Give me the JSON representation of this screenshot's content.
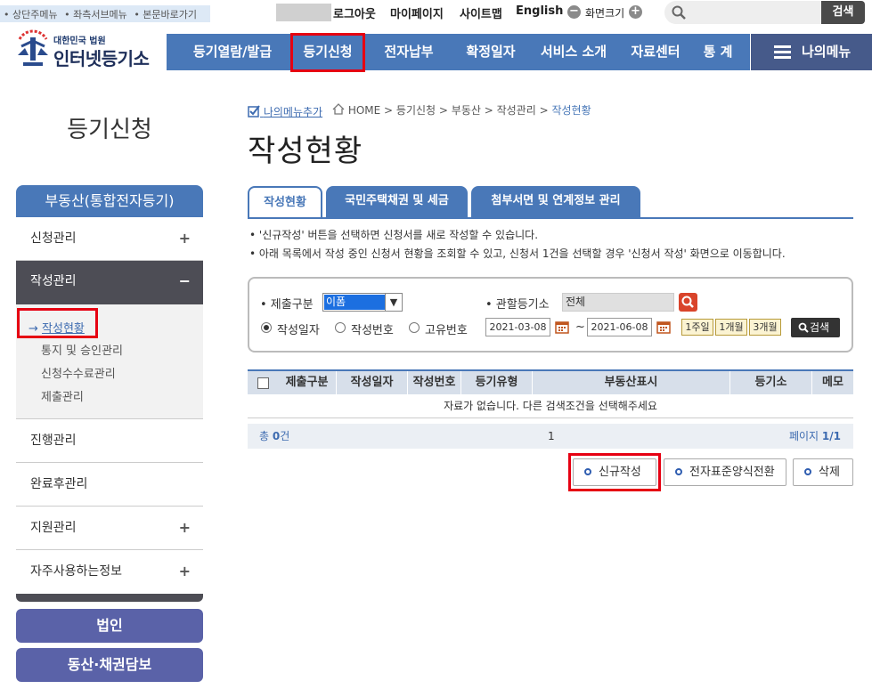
{
  "skip_links": [
    "• 상단주메뉴",
    "• 좌측서브메뉴",
    "• 본문바로가기"
  ],
  "util": {
    "logout": "로그아웃",
    "mypage": "마이페이지",
    "sitemap": "사이트맵",
    "english": "English",
    "zoom_minus": "−",
    "zoom_label": "화면크기",
    "zoom_plus": "+",
    "search_button": "검색"
  },
  "logo": {
    "org": "대한민국 법원",
    "name": "인터넷등기소"
  },
  "gnb": {
    "items": [
      "등기열람/발급",
      "등기신청",
      "전자납부",
      "확정일자",
      "서비스 소개",
      "자료센터",
      "통 계"
    ],
    "my_menu": "나의메뉴"
  },
  "sidebar": {
    "title": "등기신청",
    "section": "부동산(통합전자등기)",
    "items": [
      {
        "label": "신청관리",
        "toggle": "+"
      },
      {
        "label": "작성관리",
        "toggle": "−"
      },
      {
        "label": "진행관리",
        "toggle": ""
      },
      {
        "label": "완료후관리",
        "toggle": ""
      },
      {
        "label": "지원관리",
        "toggle": "+"
      },
      {
        "label": "자주사용하는정보",
        "toggle": "+"
      }
    ],
    "sub_items": [
      "작성현황",
      "통지 및 승인관리",
      "신청수수료관리",
      "제출관리"
    ],
    "buttons": [
      "법인",
      "동산·채권담보"
    ]
  },
  "breadcrumb": {
    "my_menu_add": "나의메뉴추가",
    "home": "HOME",
    "path": [
      "등기신청",
      "부동산",
      "작성관리"
    ],
    "current": "작성현황"
  },
  "page_title": "작성현황",
  "tabs": [
    "작성현황",
    "국민주택채권 및 세금",
    "첨부서면 및 연계정보 관리"
  ],
  "notes": [
    "• '신규작성' 버튼을 선택하면 신청서를 새로 작성할 수 있습니다.",
    "• 아래 목록에서 작성 중인 신청서 현황을 조회할 수 있고, 신청서 1건을 선택할 경우 '신청서 작성' 화면으로 이동합니다."
  ],
  "filter": {
    "submit_type_label": "• 제출구분",
    "submit_type_value": "이폼",
    "court_label": "• 관할등기소",
    "court_value": "전체",
    "radios": [
      "작성일자",
      "작성번호",
      "고유번호"
    ],
    "date_from": "2021-03-08",
    "date_sep": "~",
    "date_to": "2021-06-08",
    "periods": [
      "1주일",
      "1개월",
      "3개월"
    ],
    "search": "검색"
  },
  "table": {
    "columns": [
      "제출구분",
      "작성일자",
      "작성번호",
      "등기유형",
      "부동산표시",
      "등기소",
      "메모"
    ],
    "empty_message": "자료가 없습니다. 다른 검색조건을 선택해주세요"
  },
  "pager": {
    "total_prefix": "총 ",
    "total_count": "0",
    "total_suffix": "건",
    "page_number": "1",
    "page_label": "페이지 ",
    "page_info": "1/1"
  },
  "actions": [
    "신규작성",
    "전자표준양식전환",
    "삭제"
  ],
  "colors": {
    "primary": "#4978b8",
    "dark": "#4d4d55",
    "highlight": "#e60012",
    "side_button": "#5a62a8"
  }
}
